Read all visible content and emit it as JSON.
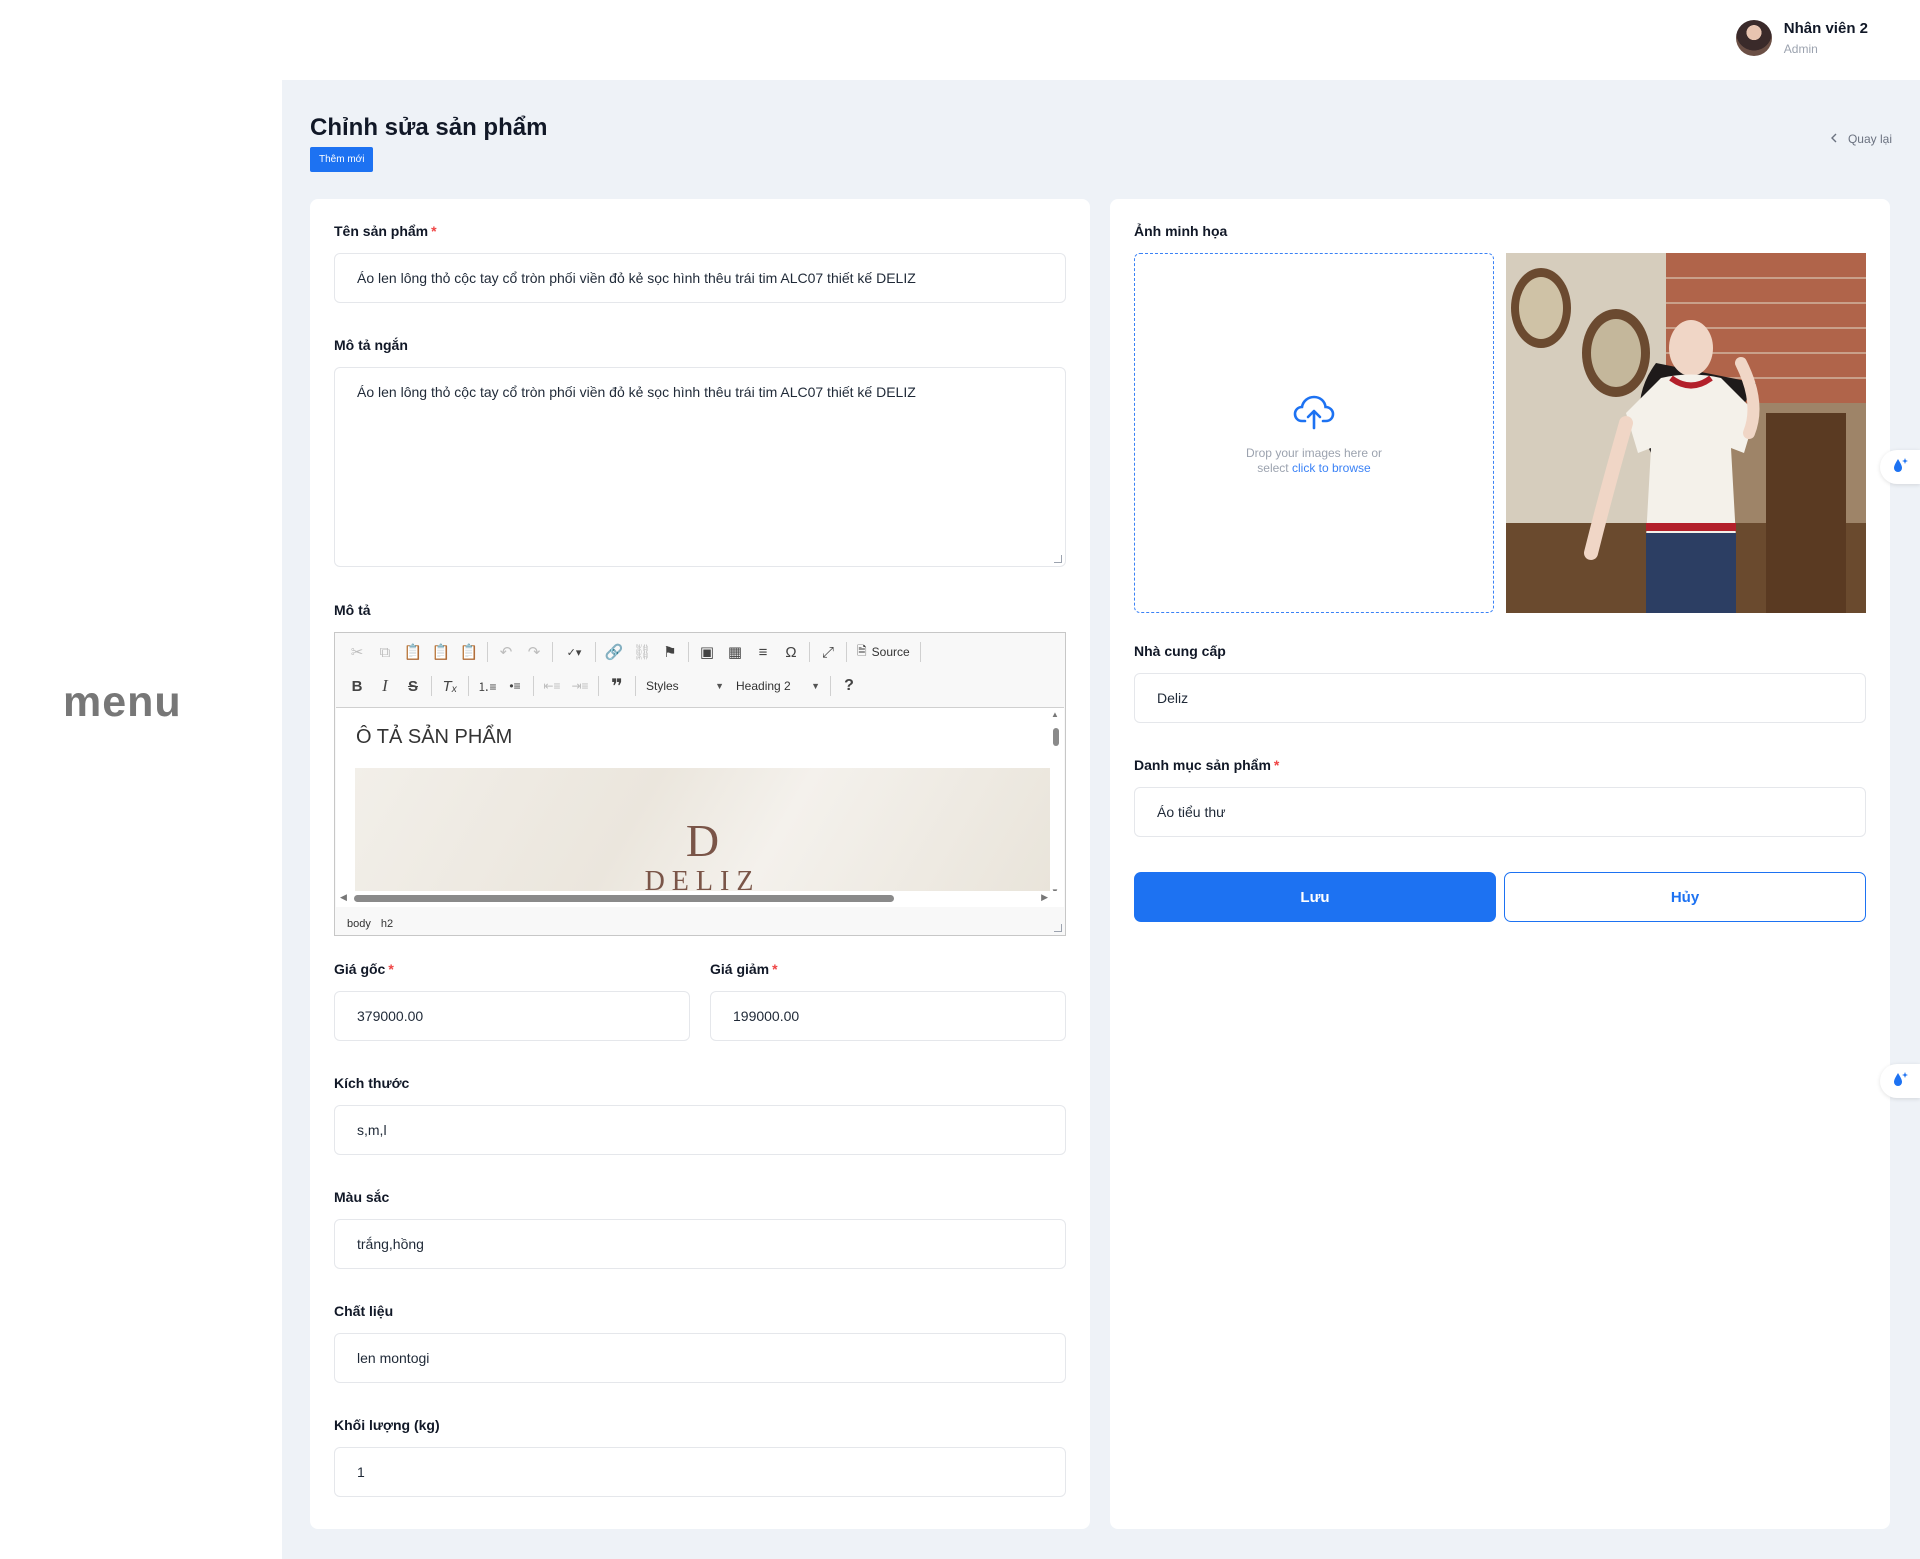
{
  "sidebar": {
    "menu_label": "menu"
  },
  "header": {
    "user_name": "Nhân viên 2",
    "user_role": "Admin"
  },
  "page": {
    "title": "Chỉnh sửa sản phẩm",
    "badge": "Thêm mới",
    "back_label": "Quay lại"
  },
  "form_left": {
    "name": {
      "label": "Tên sản phẩm",
      "value": "Áo len lông thỏ cộc tay cổ tròn phối viền đỏ kẻ sọc hình thêu trái tim ALC07 thiết kế DELIZ"
    },
    "short_desc": {
      "label": "Mô tả ngắn",
      "value": "Áo len lông thỏ cộc tay cổ tròn phối viền đỏ kẻ sọc hình thêu trái tim ALC07 thiết kế DELIZ"
    },
    "description": {
      "label": "Mô tả",
      "toolbar": {
        "source_label": "Source",
        "styles_label": "Styles",
        "format_label": "Heading 2"
      },
      "content_heading": "Ô TẢ SẢN PHẨM",
      "banner_logo": "D",
      "banner_text": "DELIZ",
      "path": [
        "body",
        "h2"
      ]
    },
    "price": {
      "label": "Giá gốc",
      "value": "379000.00"
    },
    "sale_price": {
      "label": "Giá giảm",
      "value": "199000.00"
    },
    "size": {
      "label": "Kích thước",
      "value": "s,m,l"
    },
    "color": {
      "label": "Màu sắc",
      "value": "trắng,hồng"
    },
    "material": {
      "label": "Chất liệu",
      "value": "len montogi"
    },
    "weight": {
      "label": "Khối lượng (kg)",
      "value": "1"
    }
  },
  "form_right": {
    "image": {
      "label": "Ảnh minh họa",
      "drop_text": "Drop your images here or",
      "drop_text_2": "select",
      "browse_link": "click to browse"
    },
    "supplier": {
      "label": "Nhà cung cấp",
      "value": "Deliz"
    },
    "category": {
      "label": "Danh mục sản phẩm",
      "value": "Áo tiểu thư"
    },
    "save_label": "Lưu",
    "cancel_label": "Hủy"
  },
  "colors": {
    "primary": "#1d72f2",
    "required": "#ef4444",
    "background": "#eef2f7"
  }
}
